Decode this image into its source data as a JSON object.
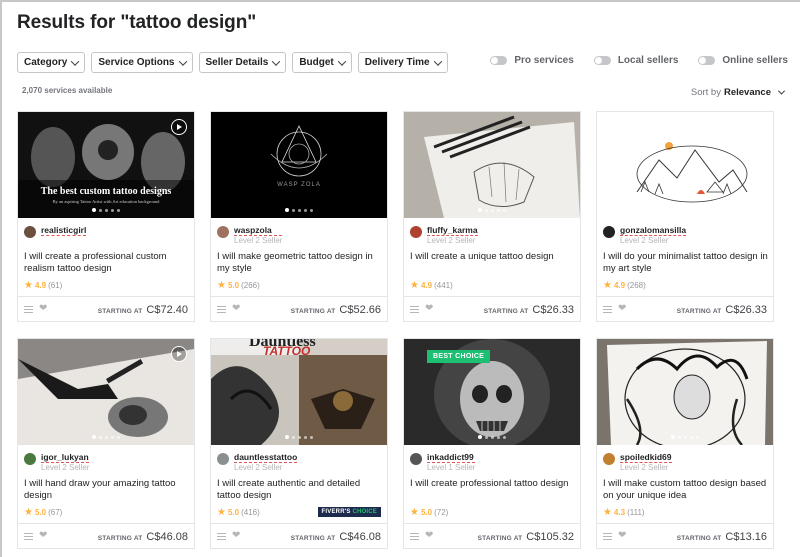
{
  "title": "Results for \"tattoo design\"",
  "filters": [
    "Category",
    "Service Options",
    "Seller Details",
    "Budget",
    "Delivery Time"
  ],
  "toggles": [
    "Pro services",
    "Local sellers",
    "Online sellers"
  ],
  "count": "2,070 services available",
  "sort": {
    "label": "Sort by",
    "value": "Relevance"
  },
  "price_label": "STARTING AT",
  "gigs": [
    {
      "seller": "realisticgirl",
      "level": "",
      "title": "I will create a professional custom realism tattoo design",
      "rating": "4.9",
      "reviews": "(61)",
      "price": "C$72.40",
      "thumb_text": "The best custom tattoo designs",
      "thumb_sub": "By an aspiring Tattoo Artist with Art education background",
      "video": true
    },
    {
      "seller": "waspzola",
      "level": "Level 2 Seller",
      "title": "I will make geometric tattoo design in my style",
      "rating": "5.0",
      "reviews": "(266)",
      "price": "C$52.66",
      "thumb_text": "WASP ZOLA"
    },
    {
      "seller": "fluffy_karma",
      "level": "Level 2 Seller",
      "title": "I will create a unique tattoo design",
      "rating": "4.9",
      "reviews": "(441)",
      "price": "C$26.33"
    },
    {
      "seller": "gonzalomansilla",
      "level": "Level 2 Seller",
      "title": "I will do your minimalist tattoo design in my art style",
      "rating": "4.9",
      "reviews": "(268)",
      "price": "C$26.33"
    },
    {
      "seller": "igor_lukyan",
      "level": "Level 2 Seller",
      "title": "I will hand draw your amazing tattoo design",
      "rating": "5.0",
      "reviews": "(67)",
      "price": "C$46.08",
      "video": true
    },
    {
      "seller": "dauntlesstattoo",
      "level": "Level 2 Seller",
      "title": "I will create authentic and detailed tattoo design",
      "rating": "5.0",
      "reviews": "(416)",
      "price": "C$46.08",
      "thumb_text": "TATTOO",
      "thumb_sub": "Dauntless",
      "fivers": {
        "pre": "FIVERR'S",
        "post": "CHOICE"
      }
    },
    {
      "seller": "inkaddict99",
      "level": "Level 1 Seller",
      "title": "I will create professional tattoo design",
      "rating": "5.0",
      "reviews": "(72)",
      "price": "C$105.32",
      "badge": "BEST CHOICE"
    },
    {
      "seller": "spoiledkid69",
      "level": "Level 2 Seller",
      "title": "I will make custom tattoo design based on your unique idea",
      "rating": "4.3",
      "reviews": "(111)",
      "price": "C$13.16"
    }
  ],
  "colors": {
    "accent": "#1dbf73",
    "star": "#ffb33e"
  }
}
